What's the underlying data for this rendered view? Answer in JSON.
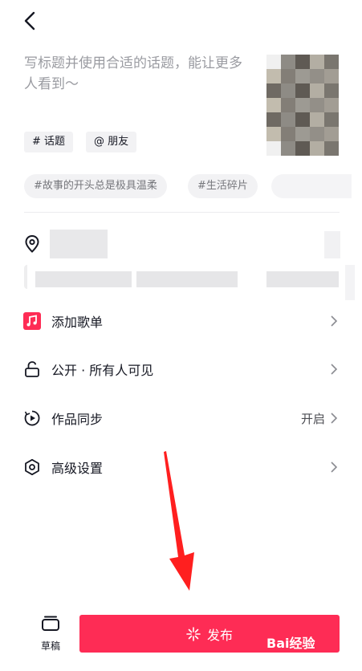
{
  "header": {
    "back_icon": "chevron-left-icon"
  },
  "composer": {
    "placeholder": "写标题并使用合适的话题，能让更多人看到～",
    "chips": [
      {
        "label": "# 话题"
      },
      {
        "label": "@ 朋友"
      }
    ],
    "suggestions": [
      {
        "label": "#故事的开头总是极具温柔"
      },
      {
        "label": "#生活碎片"
      }
    ]
  },
  "settings": [
    {
      "icon": "music-note-icon",
      "label": "添加歌单",
      "value": ""
    },
    {
      "icon": "unlock-icon",
      "label": "公开 · 所有人可见",
      "value": ""
    },
    {
      "icon": "sync-play-icon",
      "label": "作品同步",
      "value": "开启"
    },
    {
      "icon": "hexagon-gear-icon",
      "label": "高级设置",
      "value": ""
    }
  ],
  "footer": {
    "draft_label": "草稿",
    "publish_label": "发布"
  },
  "watermark": {
    "text": "Bai经验"
  },
  "colors": {
    "accent": "#fe2c55",
    "text": "#161823",
    "muted": "#9a9ba1"
  }
}
